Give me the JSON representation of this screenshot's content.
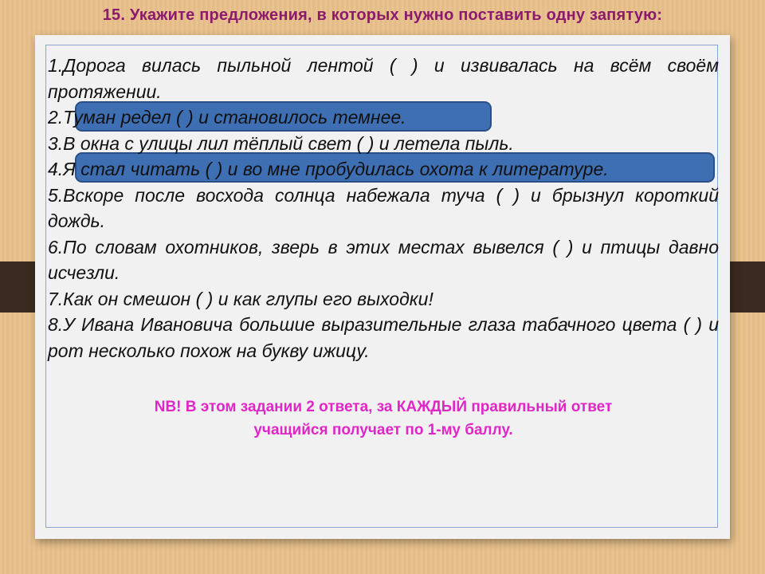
{
  "title": "15. Укажите предложения, в которых нужно поставить одну запятую:",
  "items": [
    "1.Дорога вилась пыльной лентой ( ) и извивалась на всём своём протяжении.",
    "2.Туман редел ( ) и становилось темнее.",
    "3.В окна с улицы лил тёплый свет ( ) и летела пыль.",
    "4.Я стал читать ( ) и во мне пробудилась охота к литературе.",
    "5.Вскоре после восхода солнца набежала туча ( ) и брызнул короткий дождь.",
    "6.По словам охотников, зверь в этих местах вывелся ( ) и птицы давно исчезли.",
    "7.Как он смешон ( ) и как глупы его выходки!",
    "8.У Ивана Ивановича большие выразительные глаза табачного цвета ( ) и рот несколько похож на букву ижицу."
  ],
  "highlighted_items": [
    2,
    4
  ],
  "note": {
    "line1": "NB! В этом задании 2 ответа, за КАЖДЫЙ правильный ответ",
    "line2": "учащийся получает по 1-му баллу."
  },
  "colors": {
    "title": "#8b1a6e",
    "highlight": "#3f6fb3",
    "note": "#e026c6",
    "background": "#e8c08a"
  }
}
